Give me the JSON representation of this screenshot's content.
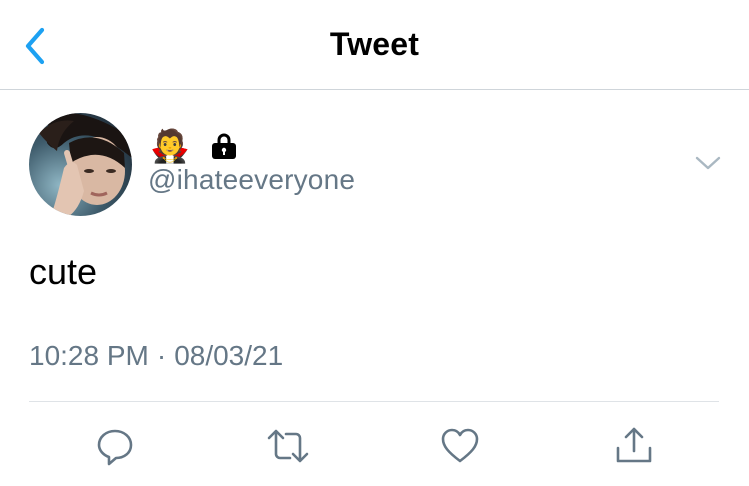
{
  "header": {
    "title": "Tweet",
    "back_icon": "chevron-left-icon"
  },
  "author": {
    "emoji": "🧛",
    "lock_icon": "lock-icon",
    "handle": "@ihateeveryone",
    "menu_icon": "chevron-down-icon"
  },
  "tweet": {
    "text": "cute",
    "time": "10:28 PM",
    "separator": "·",
    "date": "08/03/21"
  },
  "actions": {
    "reply_icon": "reply-icon",
    "retweet_icon": "retweet-icon",
    "like_icon": "heart-icon",
    "share_icon": "share-icon"
  },
  "colors": {
    "accent": "#1da1f2",
    "muted": "#657786",
    "divider": "#dfe3e7"
  }
}
